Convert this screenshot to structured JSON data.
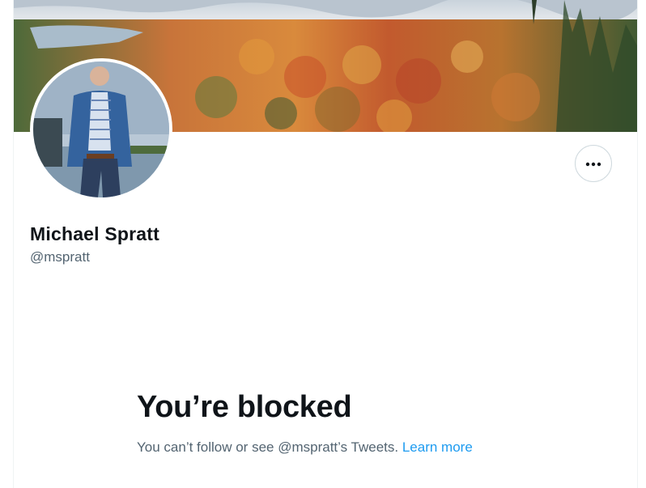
{
  "profile": {
    "display_name": "Michael Spratt",
    "handle": "@mspratt"
  },
  "header": {
    "banner_image": "autumn-forest-lake-landscape",
    "avatar_image": "man-in-blue-blazer-by-lake"
  },
  "actions": {
    "more_icon": "more-horizontal-icon"
  },
  "blocked_notice": {
    "title": "You’re blocked",
    "description": "You can’t follow or see @mspratt’s Tweets.",
    "link_label": "Learn more"
  },
  "colors": {
    "text_primary": "#0f1419",
    "text_secondary": "#536471",
    "link": "#1d9bf0",
    "border": "#cfd9de"
  }
}
